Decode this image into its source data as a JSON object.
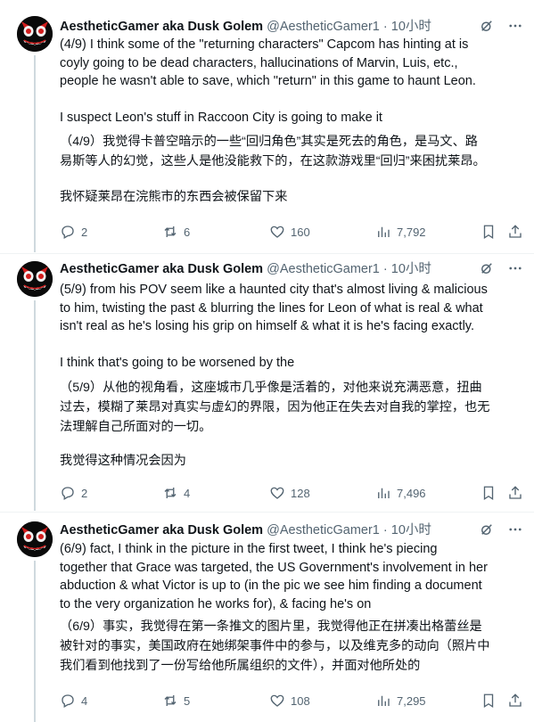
{
  "tweets": [
    {
      "name": "AestheticGamer aka Dusk Golem",
      "handle": "@AestheticGamer1",
      "separator": "·",
      "time": "10小时",
      "en_lines": [
        "(4/9) I think some of the \"returning characters\" Capcom has hinting at is",
        "coyly going to be dead characters, hallucinations of Marvin, Luis, etc.,",
        "people he wasn't able to save, which \"return\" in this game to haunt Leon.",
        "",
        "I suspect Leon's stuff in Raccoon City is going to make it"
      ],
      "cn_lines": [
        "（4/9）我觉得卡普空暗示的一些“回归角色”其实是死去的角色，是马文、路",
        "易斯等人的幻觉，这些人是他没能救下的，在这款游戏里“回归”来困扰莱昂。",
        "",
        "我怀疑莱昂在浣熊市的东西会被保留下来"
      ],
      "replies": "2",
      "reposts": "6",
      "likes": "160",
      "views": "7,792"
    },
    {
      "name": "AestheticGamer aka Dusk Golem",
      "handle": "@AestheticGamer1",
      "separator": "·",
      "time": "10小时",
      "en_lines": [
        "(5/9) from his POV seem like a haunted city that's almost living & malicious",
        "to him, twisting the past & blurring the lines for Leon of what is real & what",
        "isn't real as he's losing his grip on himself & what it is he's facing exactly.",
        "",
        "I think that's going to be worsened by the"
      ],
      "cn_lines": [
        "（5/9）从他的视角看，这座城市几乎像是活着的，对他来说充满恶意，扭曲",
        "过去，模糊了莱昂对真实与虚幻的界限，因为他正在失去对自我的掌控，也无",
        "法理解自己所面对的一切。",
        "",
        "我觉得这种情况会因为"
      ],
      "replies": "2",
      "reposts": "4",
      "likes": "128",
      "views": "7,496"
    },
    {
      "name": "AestheticGamer aka Dusk Golem",
      "handle": "@AestheticGamer1",
      "separator": "·",
      "time": "10小时",
      "en_lines": [
        "(6/9) fact, I think in the picture in the first tweet, I think he's piecing",
        "together that Grace was targeted, the US Government's involvement in her",
        "abduction & what Victor is up to (in the pic we see him finding a document",
        "to the very organization he works for), & facing he's on"
      ],
      "cn_lines": [
        "（6/9）事实，我觉得在第一条推文的图片里，我觉得他正在拼凑出格蕾丝是",
        "被针对的事实，美国政府在她绑架事件中的参与，以及维克多的动向（照片中",
        "我们看到他找到了一份写给他所属组织的文件），并面对他所处的"
      ],
      "replies": "4",
      "reposts": "5",
      "likes": "108",
      "views": "7,295"
    }
  ],
  "icons": {
    "grok": "grok-icon",
    "more": "more-icon",
    "reply": "reply-icon",
    "repost": "repost-icon",
    "like": "like-icon",
    "views": "views-icon",
    "bookmark": "bookmark-icon",
    "share": "share-icon"
  },
  "colors": {
    "text": "#0f1419",
    "secondary": "#536471",
    "thread_line": "#cfd9de",
    "divider": "#eff3f4"
  }
}
